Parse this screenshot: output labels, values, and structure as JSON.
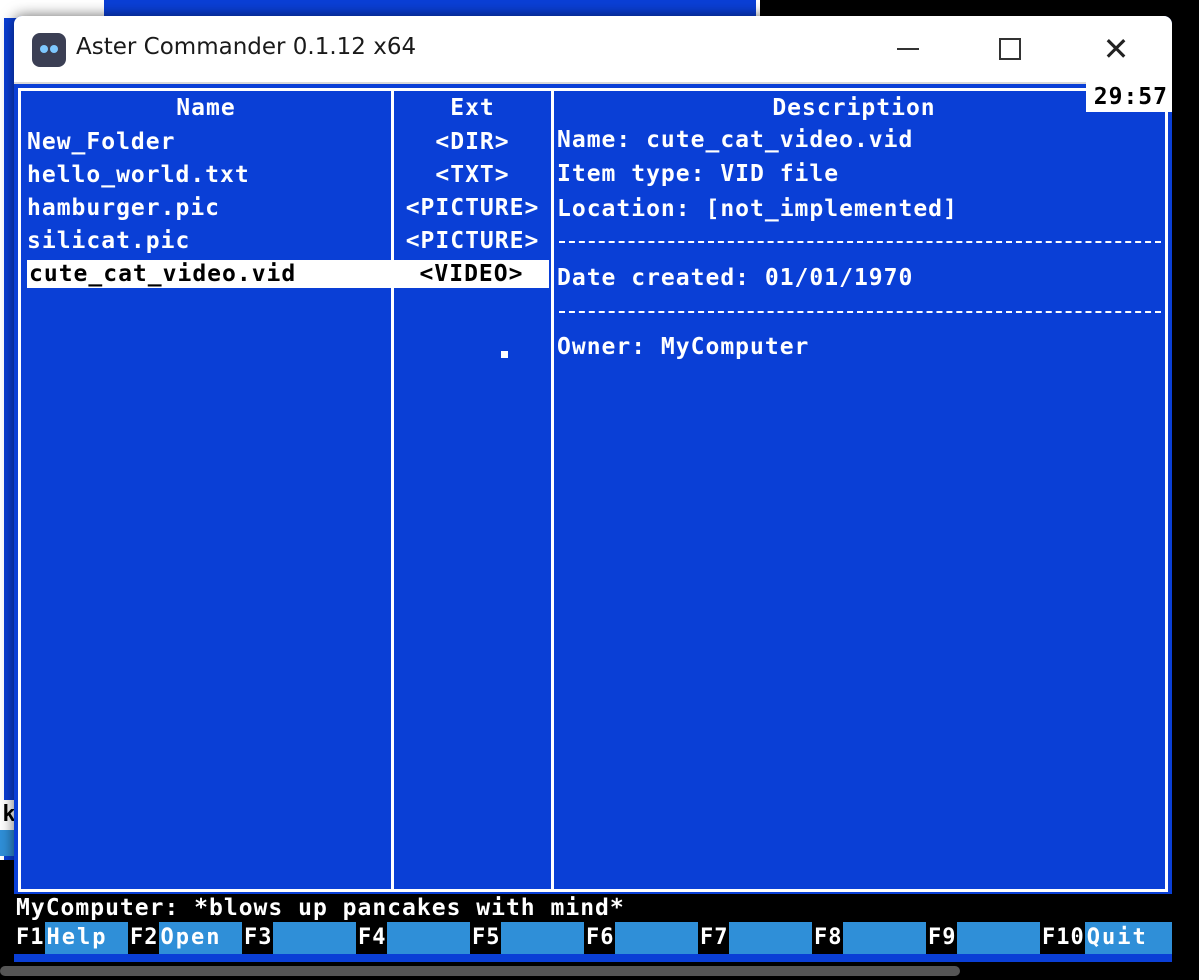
{
  "window": {
    "title": "Aster Commander 0.1.12 x64",
    "clock": "29:57"
  },
  "columns": {
    "name": "Name",
    "ext": "Ext",
    "description": "Description"
  },
  "files": [
    {
      "name": "New_Folder",
      "ext": "<DIR>"
    },
    {
      "name": "hello_world.txt",
      "ext": "<TXT>"
    },
    {
      "name": "hamburger.pic",
      "ext": "<PICTURE>"
    },
    {
      "name": "silicat.pic",
      "ext": "<PICTURE>"
    },
    {
      "name": "cute_cat_video.vid",
      "ext": "<VIDEO>",
      "selected": true
    }
  ],
  "description": {
    "name_line": "Name: cute_cat_video.vid",
    "type_line": "Item type: VID file",
    "location_line": "Location: [not_implemented]",
    "date_line": "Date created: 01/01/1970",
    "owner_line": "Owner: MyComputer"
  },
  "status": {
    "message": "MyComputer: *blows up pancakes with mind*"
  },
  "fkeys": [
    {
      "key": "F1",
      "label": "Help"
    },
    {
      "key": "F2",
      "label": "Open"
    },
    {
      "key": "F3",
      "label": ""
    },
    {
      "key": "F4",
      "label": ""
    },
    {
      "key": "F5",
      "label": ""
    },
    {
      "key": "F6",
      "label": ""
    },
    {
      "key": "F7",
      "label": ""
    },
    {
      "key": "F8",
      "label": ""
    },
    {
      "key": "F9",
      "label": ""
    },
    {
      "key": "F10",
      "label": "Quit"
    }
  ],
  "background": {
    "fragment_text": "k"
  },
  "colors": {
    "panel_blue": "#0a3fd6",
    "fkey_blue": "#2f8fd8"
  }
}
